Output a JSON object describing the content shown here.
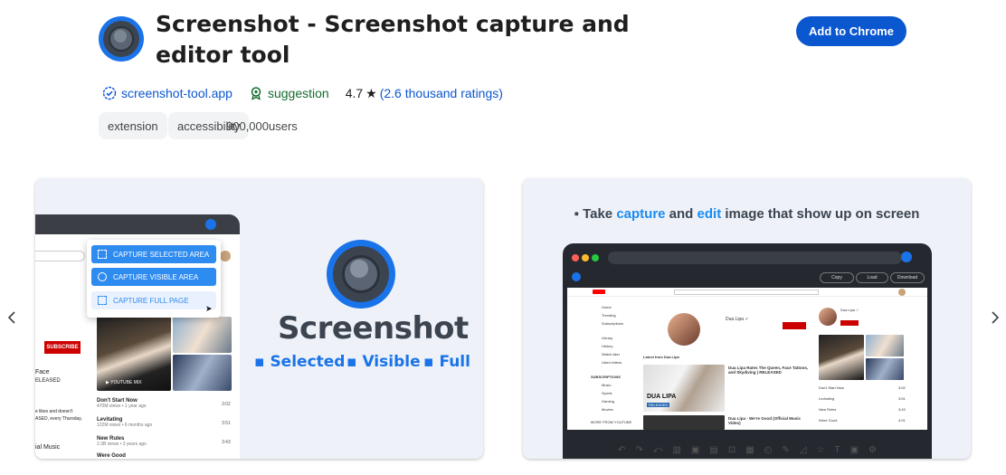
{
  "header": {
    "title": "Screenshot - Screenshot capture and editor tool",
    "add_button_label": "Add to Chrome",
    "website": "screenshot-tool.app",
    "featured_label": "suggestion",
    "rating": "4.7",
    "ratings_count": "(2.6 thousand ratings)",
    "tags": [
      "extension",
      "accessibility"
    ],
    "users": "900,000users"
  },
  "colors": {
    "accent": "#0b57d0",
    "featured_green": "#146c2e",
    "brand_blue": "#1a73e8"
  },
  "carousel": {
    "prev_icon": "chevron-left-icon",
    "next_icon": "chevron-right-icon",
    "slide1": {
      "menu_options": [
        "CAPTURE SELECTED AREA",
        "CAPTURE VISIBLE AREA",
        "CAPTURE FULL PAGE"
      ],
      "subscribe": "SUBSCRIBE",
      "wordmark": "Screenshot",
      "features": [
        "▪ Selected",
        "▪ Visible",
        "▪ Full"
      ],
      "video_badge": "▶ YOUTUBE MIX",
      "left_texts": [
        "Face",
        "ELEASED",
        "e likes and doesn't",
        "ASED, every Thursday,",
        "ial Music"
      ],
      "videos": [
        {
          "title": "Don't Start Now",
          "meta": "470M views • 1 year ago",
          "time": "3:02"
        },
        {
          "title": "Levitating",
          "meta": "122M views • 6 months ago",
          "time": "3:51"
        },
        {
          "title": "New Rules",
          "meta": "2.3B views • 3 years ago",
          "time": "3:43"
        },
        {
          "title": "Were Good",
          "meta": "",
          "time": ""
        }
      ]
    },
    "slide2": {
      "heading_prefix": "▪ Take ",
      "heading_capture": "capture",
      "heading_and": " and ",
      "heading_edit": "edit",
      "heading_suffix": " image that show up on screen",
      "buttons": [
        "Copy",
        "Load",
        "Download"
      ],
      "channel_name": "Dua Lipa ✓",
      "latest_label": "Latest from Dua Lipa",
      "video_title": "Dua Lipa Rates The Queen, Face Tattoos, and Skydiving | RELEASED",
      "video2_title": "Dua Lipa - We're Good (Official Music Video)",
      "thumb_label": "DUA LIPA",
      "released_label": "RELEASED",
      "sidebar_items": [
        "Home",
        "Trending",
        "Subscriptions",
        "Library",
        "History",
        "Watch later",
        "Liked videos"
      ],
      "subscriptions_label": "SUBSCRIPTIONS",
      "sub_items": [
        "Music",
        "Sports",
        "Gaming",
        "Movies"
      ],
      "more_label": "MORE FROM YOUTUBE",
      "right_videos": [
        "Don't Start Now",
        "Levitating",
        "New Rules",
        "Were Good"
      ],
      "right_times": [
        "3:02",
        "3:51",
        "3:43",
        "4:01"
      ],
      "toolbar_icons": [
        "↶",
        "↷",
        "⤺",
        "▥",
        "▣",
        "▤",
        "⊡",
        "▦",
        "◴",
        "✎",
        "◿",
        "☆",
        "T",
        "▣",
        "⚙"
      ]
    }
  }
}
